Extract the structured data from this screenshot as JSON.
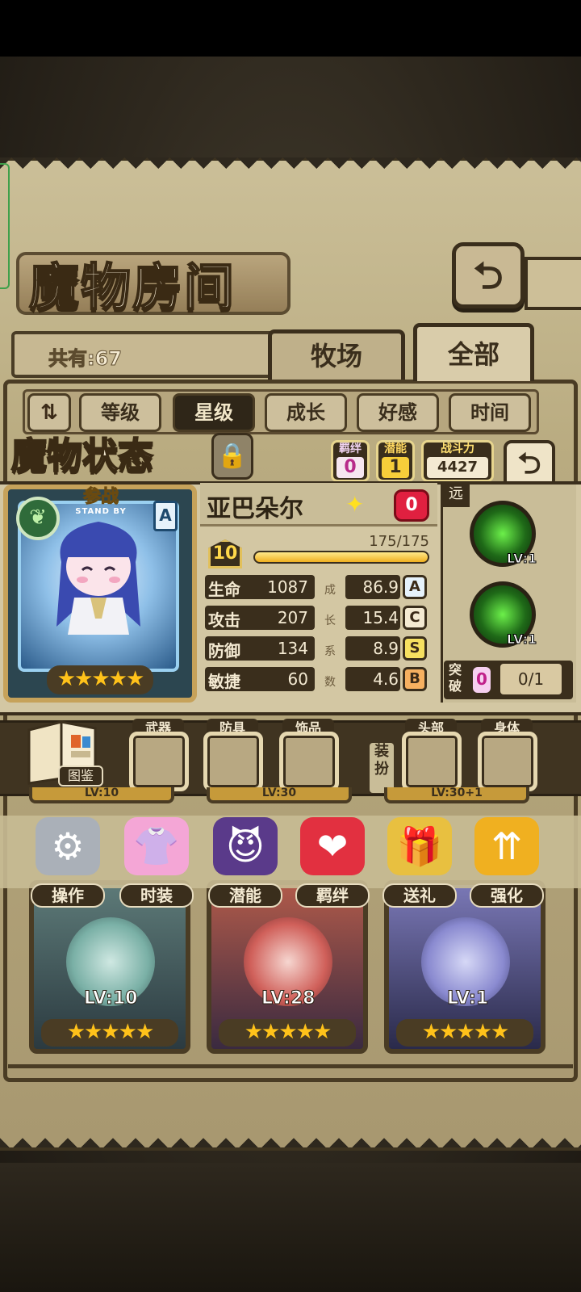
{
  "room": {
    "title": "魔物房间",
    "count_label": "共有:67",
    "tabs": [
      {
        "label": "牧场"
      },
      {
        "label": "全部"
      }
    ],
    "back_label": "⮌"
  },
  "sort": {
    "buttons": [
      {
        "label": "等级"
      },
      {
        "label": "星级",
        "active": true
      },
      {
        "label": "成长"
      },
      {
        "label": "好感"
      },
      {
        "label": "时间"
      }
    ]
  },
  "status": {
    "title": "魔物状态",
    "bond_label": "羁绊",
    "bond_value": "0",
    "potential_label": "潜能",
    "potential_value": "1",
    "power_label": "战斗力",
    "power_value": "4427",
    "standby_cn": "参战",
    "standby_en": "STAND BY",
    "range_tag": "A",
    "star_rating": 5,
    "name": "亚巴朵尔",
    "heart_value": "0",
    "level": "10",
    "exp_text": "175/175",
    "exp_fraction": 1.0,
    "stats": [
      {
        "label": "生命",
        "value": "1087",
        "growth": "86.9",
        "grade": "A"
      },
      {
        "label": "攻击",
        "value": "207",
        "growth": "15.4",
        "grade": "C"
      },
      {
        "label": "防御",
        "value": "134",
        "growth": "8.9",
        "grade": "S"
      },
      {
        "label": "敏捷",
        "value": "60",
        "growth": "4.6",
        "grade": "B"
      }
    ],
    "growth_vertical_label": [
      "成",
      "长",
      "系",
      "数"
    ],
    "attack_range": "远",
    "skills": [
      {
        "level": "LV:1"
      },
      {
        "level": "LV:1"
      }
    ],
    "break_label": "突破",
    "break_badge": "0",
    "break_value": "0/1"
  },
  "equipment": {
    "codex_label": "图鉴",
    "slots_left": [
      {
        "label": "武器"
      },
      {
        "label": "防具"
      },
      {
        "label": "饰品"
      }
    ],
    "dress_label": "装扮",
    "slots_right": [
      {
        "label": "头部"
      },
      {
        "label": "身体"
      }
    ]
  },
  "actions": [
    {
      "label": "操作",
      "icon": "gear-icon"
    },
    {
      "label": "时装",
      "icon": "outfit-icon"
    },
    {
      "label": "潜能",
      "icon": "demon-icon"
    },
    {
      "label": "羁绊",
      "icon": "hearts-icon"
    },
    {
      "label": "送礼",
      "icon": "gift-icon"
    },
    {
      "label": "强化",
      "icon": "upgrade-arrows-icon"
    }
  ],
  "monster_cards": [
    {
      "level": "LV:10",
      "stars": 5
    },
    {
      "level": "LV:28",
      "stars": 5
    },
    {
      "level": "LV:1",
      "stars": 5
    }
  ],
  "partial_cards": [
    {
      "level": "LV:10"
    },
    {
      "level": "LV:30"
    },
    {
      "level": "LV:30+1"
    }
  ],
  "colors": {
    "accent_gold": "#ffc21a",
    "frame_dark": "#3a2e1c",
    "parchment": "#cbbf98"
  }
}
